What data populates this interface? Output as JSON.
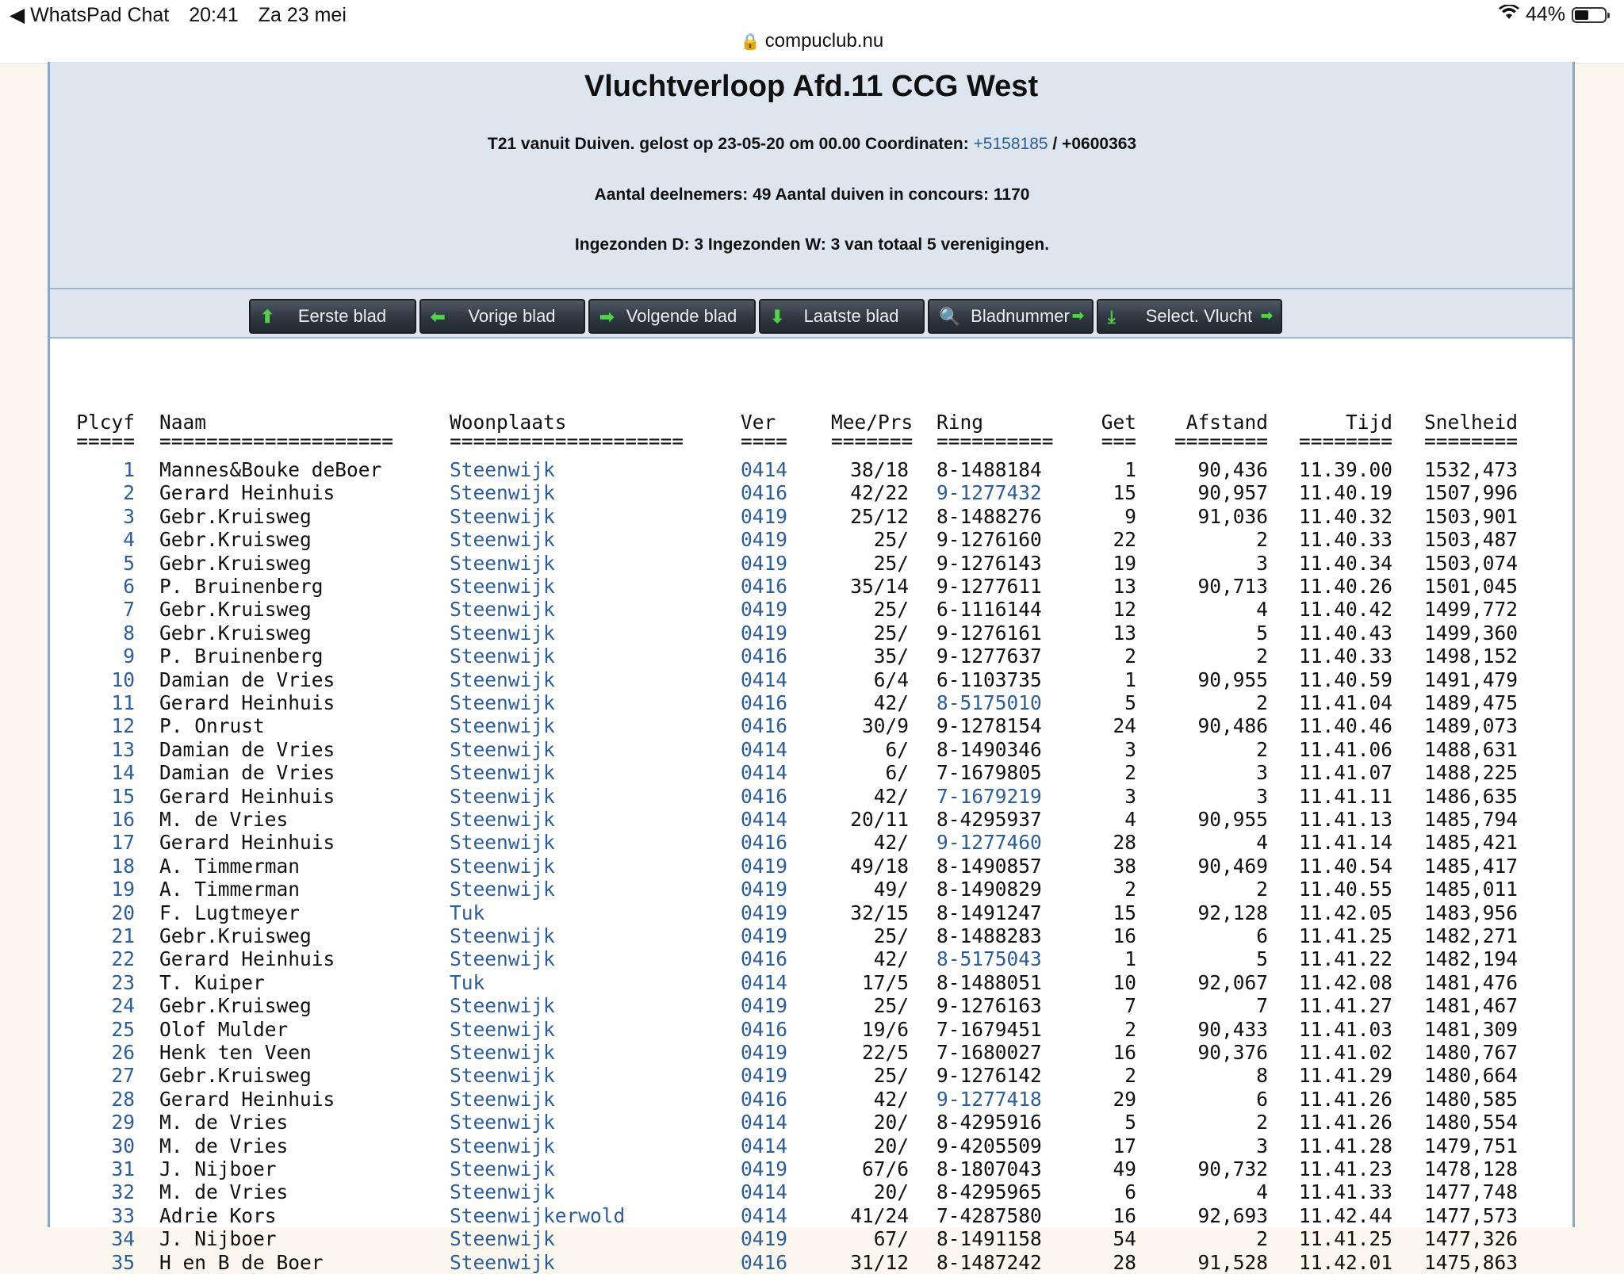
{
  "statusbar": {
    "back_app": "◀ WhatsPad Chat",
    "time": "20:41",
    "date": "Za 23 mei",
    "battery": "44%",
    "url": "compuclub.nu"
  },
  "header": {
    "title": "Vluchtverloop Afd.11 CCG West",
    "line1_prefix": "T21 vanuit Duiven. gelost op 23-05-20 om 00.00 Coordinaten:",
    "line1_lat": "+5158185",
    "line1_sep": " / ",
    "line1_lon": "+0600363",
    "line2": "Aantal deelnemers: 49 Aantal duiven in concours: 1170",
    "line3": "Ingezonden D: 3 Ingezonden W: 3 van totaal 5 verenigingen."
  },
  "nav": [
    {
      "label": "Eerste blad",
      "icon": "⬆",
      "trail": ""
    },
    {
      "label": "Vorige blad",
      "icon": "⬅",
      "trail": ""
    },
    {
      "label": "Volgende blad",
      "icon": "➡",
      "trail": ""
    },
    {
      "label": "Laatste blad",
      "icon": "⬇",
      "trail": ""
    },
    {
      "label": "Bladnummer",
      "icon": "🔍",
      "trail": "➡"
    },
    {
      "label": "Select. Vlucht",
      "icon": "⤓",
      "trail": "➡"
    }
  ],
  "table": {
    "columns": [
      "Plcyf",
      "Naam",
      "Woonplaats",
      "Ver",
      "Mee/Prs",
      "Ring",
      "Get",
      "Afstand",
      "Tijd",
      "Snelheid"
    ],
    "separators": [
      "=====",
      "====================",
      "====================",
      "====",
      "=======",
      "==========",
      "===",
      "========",
      "========",
      "========"
    ],
    "rows": [
      [
        "1",
        "Mannes&Bouke deBoer",
        "Steenwijk",
        "0414",
        "38/18",
        "8-1488184",
        "1",
        "90,436",
        "11.39.00",
        "1532,473"
      ],
      [
        "2",
        "Gerard Heinhuis",
        "Steenwijk",
        "0416",
        "42/22",
        "9-1277432",
        "15",
        "90,957",
        "11.40.19",
        "1507,996"
      ],
      [
        "3",
        "Gebr.Kruisweg",
        "Steenwijk",
        "0419",
        "25/12",
        "8-1488276",
        "9",
        "91,036",
        "11.40.32",
        "1503,901"
      ],
      [
        "4",
        "Gebr.Kruisweg",
        "Steenwijk",
        "0419",
        "25/",
        "9-1276160",
        "22",
        "2",
        "11.40.33",
        "1503,487"
      ],
      [
        "5",
        "Gebr.Kruisweg",
        "Steenwijk",
        "0419",
        "25/",
        "9-1276143",
        "19",
        "3",
        "11.40.34",
        "1503,074"
      ],
      [
        "6",
        "P. Bruinenberg",
        "Steenwijk",
        "0416",
        "35/14",
        "9-1277611",
        "13",
        "90,713",
        "11.40.26",
        "1501,045"
      ],
      [
        "7",
        "Gebr.Kruisweg",
        "Steenwijk",
        "0419",
        "25/",
        "6-1116144",
        "12",
        "4",
        "11.40.42",
        "1499,772"
      ],
      [
        "8",
        "Gebr.Kruisweg",
        "Steenwijk",
        "0419",
        "25/",
        "9-1276161",
        "13",
        "5",
        "11.40.43",
        "1499,360"
      ],
      [
        "9",
        "P. Bruinenberg",
        "Steenwijk",
        "0416",
        "35/",
        "9-1277637",
        "2",
        "2",
        "11.40.33",
        "1498,152"
      ],
      [
        "10",
        "Damian de Vries",
        "Steenwijk",
        "0414",
        "6/4",
        "6-1103735",
        "1",
        "90,955",
        "11.40.59",
        "1491,479"
      ],
      [
        "11",
        "Gerard Heinhuis",
        "Steenwijk",
        "0416",
        "42/",
        "8-5175010",
        "5",
        "2",
        "11.41.04",
        "1489,475"
      ],
      [
        "12",
        "P. Onrust",
        "Steenwijk",
        "0416",
        "30/9",
        "9-1278154",
        "24",
        "90,486",
        "11.40.46",
        "1489,073"
      ],
      [
        "13",
        "Damian de Vries",
        "Steenwijk",
        "0414",
        "6/",
        "8-1490346",
        "3",
        "2",
        "11.41.06",
        "1488,631"
      ],
      [
        "14",
        "Damian de Vries",
        "Steenwijk",
        "0414",
        "6/",
        "7-1679805",
        "2",
        "3",
        "11.41.07",
        "1488,225"
      ],
      [
        "15",
        "Gerard Heinhuis",
        "Steenwijk",
        "0416",
        "42/",
        "7-1679219",
        "3",
        "3",
        "11.41.11",
        "1486,635"
      ],
      [
        "16",
        "M. de Vries",
        "Steenwijk",
        "0414",
        "20/11",
        "8-4295937",
        "4",
        "90,955",
        "11.41.13",
        "1485,794"
      ],
      [
        "17",
        "Gerard Heinhuis",
        "Steenwijk",
        "0416",
        "42/",
        "9-1277460",
        "28",
        "4",
        "11.41.14",
        "1485,421"
      ],
      [
        "18",
        "A. Timmerman",
        "Steenwijk",
        "0419",
        "49/18",
        "8-1490857",
        "38",
        "90,469",
        "11.40.54",
        "1485,417"
      ],
      [
        "19",
        "A. Timmerman",
        "Steenwijk",
        "0419",
        "49/",
        "8-1490829",
        "2",
        "2",
        "11.40.55",
        "1485,011"
      ],
      [
        "20",
        "F. Lugtmeyer",
        "Tuk",
        "0419",
        "32/15",
        "8-1491247",
        "15",
        "92,128",
        "11.42.05",
        "1483,956"
      ],
      [
        "21",
        "Gebr.Kruisweg",
        "Steenwijk",
        "0419",
        "25/",
        "8-1488283",
        "16",
        "6",
        "11.41.25",
        "1482,271"
      ],
      [
        "22",
        "Gerard Heinhuis",
        "Steenwijk",
        "0416",
        "42/",
        "8-5175043",
        "1",
        "5",
        "11.41.22",
        "1482,194"
      ],
      [
        "23",
        "T. Kuiper",
        "Tuk",
        "0414",
        "17/5",
        "8-1488051",
        "10",
        "92,067",
        "11.42.08",
        "1481,476"
      ],
      [
        "24",
        "Gebr.Kruisweg",
        "Steenwijk",
        "0419",
        "25/",
        "9-1276163",
        "7",
        "7",
        "11.41.27",
        "1481,467"
      ],
      [
        "25",
        "Olof Mulder",
        "Steenwijk",
        "0416",
        "19/6",
        "7-1679451",
        "2",
        "90,433",
        "11.41.03",
        "1481,309"
      ],
      [
        "26",
        "Henk ten Veen",
        "Steenwijk",
        "0419",
        "22/5",
        "7-1680027",
        "16",
        "90,376",
        "11.41.02",
        "1480,767"
      ],
      [
        "27",
        "Gebr.Kruisweg",
        "Steenwijk",
        "0419",
        "25/",
        "9-1276142",
        "2",
        "8",
        "11.41.29",
        "1480,664"
      ],
      [
        "28",
        "Gerard Heinhuis",
        "Steenwijk",
        "0416",
        "42/",
        "9-1277418",
        "29",
        "6",
        "11.41.26",
        "1480,585"
      ],
      [
        "29",
        "M. de Vries",
        "Steenwijk",
        "0414",
        "20/",
        "8-4295916",
        "5",
        "2",
        "11.41.26",
        "1480,554"
      ],
      [
        "30",
        "M. de Vries",
        "Steenwijk",
        "0414",
        "20/",
        "9-4205509",
        "17",
        "3",
        "11.41.28",
        "1479,751"
      ],
      [
        "31",
        "J. Nijboer",
        "Steenwijk",
        "0419",
        "67/6",
        "8-1807043",
        "49",
        "90,732",
        "11.41.23",
        "1478,128"
      ],
      [
        "32",
        "M. de Vries",
        "Steenwijk",
        "0414",
        "20/",
        "8-4295965",
        "6",
        "4",
        "11.41.33",
        "1477,748"
      ],
      [
        "33",
        "Adrie Kors",
        "Steenwijkerwold",
        "0414",
        "41/24",
        "7-4287580",
        "16",
        "92,693",
        "11.42.44",
        "1477,573"
      ],
      [
        "34",
        "J. Nijboer",
        "Steenwijk",
        "0419",
        "67/",
        "8-1491158",
        "54",
        "2",
        "11.41.25",
        "1477,326"
      ],
      [
        "35",
        "H en B de Boer",
        "Steenwijk",
        "0416",
        "31/12",
        "8-1487242",
        "28",
        "91,528",
        "11.42.01",
        "1475,863"
      ]
    ],
    "blue_ring_rows": [
      2,
      11,
      15,
      17,
      22,
      28
    ]
  },
  "colors": {
    "link": "#2d5d97",
    "header_bg": "#dde5ef",
    "button_icon": "#56d04a"
  }
}
